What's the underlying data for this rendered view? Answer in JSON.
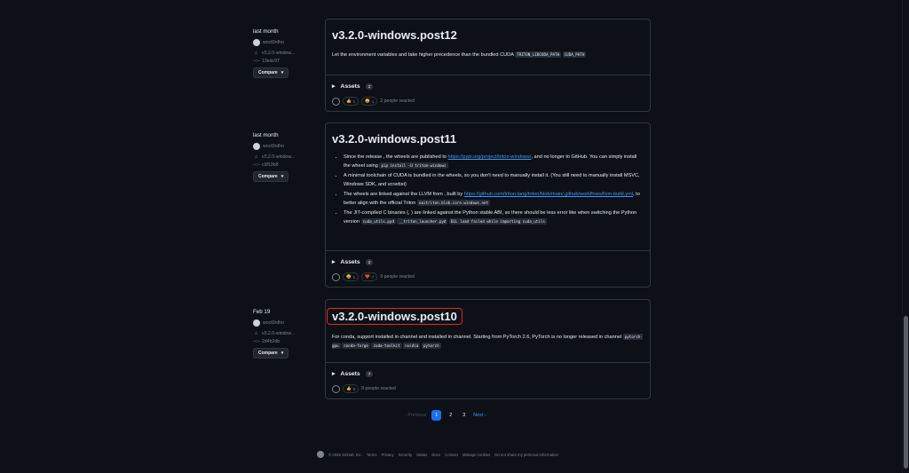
{
  "releases": [
    {
      "date": "last month",
      "author": "woct0rdho",
      "tag": "v3.2.0-window...",
      "commit": "13edc97",
      "compare_label": "Compare",
      "title": "v3.2.0-windows.post12",
      "description": "Let the environment variables and take higher precedence than the bundled CUDA",
      "codes": [
        "TRITON_LIBCUDA_PATH",
        "CUDA_PATH"
      ],
      "assets_label": "Assets",
      "assets_count": "2",
      "reactions": [
        {
          "emoji": "👍",
          "count": "1"
        },
        {
          "emoji": "😄",
          "count": "1"
        }
      ],
      "reacted_text": "2 people reacted"
    },
    {
      "date": "last month",
      "author": "woct0rdho",
      "tag": "v3.2.0-window...",
      "commit": "c9f13b8",
      "compare_label": "Compare",
      "title": "v3.2.0-windows.post11",
      "bullets": {
        "b1": {
          "t1": "Since the release , the wheels are published to ",
          "link": "https://pypi.org/project/triton-windows/",
          "t2": ", and no longer to GitHub. You can simply install the wheel using ",
          "code": "pip install -U triton-windows"
        },
        "b2": {
          "t1": "A minimal toolchain of CUDA is bundled in the wheels, so you don't need to manually install it. (You still need to manually install MSVC, Windows SDK, and vcredist)"
        },
        "b3": {
          "t1": "The wheels are linked against the LLVM from , built by ",
          "link": "https://github.com/triton-lang/triton/blob/main/.github/workflows/llvm-build.yml",
          "t2": ", to better align with the official Triton",
          "code": "oaitriton.blob.core.windows.net"
        },
        "b4": {
          "t1": "The JIT-compiled C binaries (, ) are linked against the Python stable ABI, so there should be less error like when switching the Python version",
          "codes": [
            "cuda_utils.pyd",
            "__triton_launcher.pyd",
            "DLL load failed while importing cuda_utils"
          ]
        }
      },
      "assets_label": "Assets",
      "assets_count": "2",
      "reactions": [
        {
          "emoji": "😄",
          "count": "1"
        },
        {
          "emoji": "❤️",
          "count": "7"
        }
      ],
      "reacted_text": "9 people reacted"
    },
    {
      "date": "Feb 19",
      "author": "woct0rdho",
      "tag": "v3.2.0-window...",
      "commit": "2d4b2db",
      "compare_label": "Compare",
      "title": "v3.2.0-windows.post10",
      "description": "For conda, support installed in channel and installed in channel. Starting from PyTorch 2.6, PyTorch is no longer released in channel",
      "codes": [
        "pytorch-gpu",
        "conda-forge",
        "cuda-toolkit",
        "nvidia",
        "pytorch"
      ],
      "assets_label": "Assets",
      "assets_count": "7",
      "reactions": [
        {
          "emoji": "👍",
          "count": "9"
        }
      ],
      "reacted_text": "9 people reacted"
    }
  ],
  "pagination": {
    "previous": "‹ Previous",
    "pages": [
      "1",
      "2",
      "3"
    ],
    "next": "Next ›"
  },
  "footer": {
    "copyright": "© 2025 GitHub, Inc.",
    "links": [
      "Terms",
      "Privacy",
      "Security",
      "Status",
      "Docs",
      "Contact",
      "Manage cookies",
      "Do not share my personal information"
    ]
  },
  "colors": {
    "accent": "#1f6feb",
    "link": "#4493f8",
    "highlight": "#e0252b"
  }
}
